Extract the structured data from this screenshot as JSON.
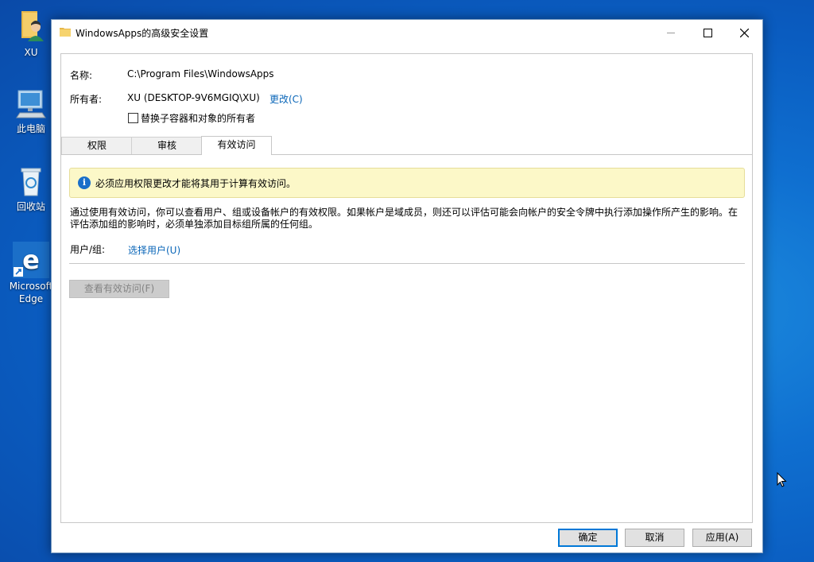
{
  "desktop": {
    "icons": [
      {
        "label": "XU",
        "icon": "user-folder-icon"
      },
      {
        "label": "此电脑",
        "icon": "computer-icon"
      },
      {
        "label": "回收站",
        "icon": "recycle-bin-icon"
      },
      {
        "label": "Microsoft Edge",
        "icon": "edge-icon"
      }
    ]
  },
  "window": {
    "title": "WindowsApps的高级安全设置",
    "name_label": "名称:",
    "name_value": "C:\\Program Files\\WindowsApps",
    "owner_label": "所有者:",
    "owner_value": "XU (DESKTOP-9V6MGIQ\\XU)",
    "change_link": "更改(C)",
    "replace_owner_checkbox": "替换子容器和对象的所有者",
    "tabs": [
      {
        "label": "权限",
        "active": false
      },
      {
        "label": "审核",
        "active": false
      },
      {
        "label": "有效访问",
        "active": true
      }
    ],
    "info_message": "必须应用权限更改才能将其用于计算有效访问。",
    "description": "通过使用有效访问，你可以查看用户、组或设备帐户的有效权限。如果帐户是域成员，则还可以评估可能会向帐户的安全令牌中执行添加操作所产生的影响。在评估添加组的影响时，必须单独添加目标组所属的任何组。",
    "user_group_label": "用户/组:",
    "select_user_link": "选择用户(U)",
    "view_access_button": "查看有效访问(F)",
    "buttons": {
      "ok": "确定",
      "cancel": "取消",
      "apply": "应用(A)"
    }
  },
  "colors": {
    "accent": "#0078d7",
    "link": "#0a66b8",
    "info_bg": "#fcf8c8"
  }
}
